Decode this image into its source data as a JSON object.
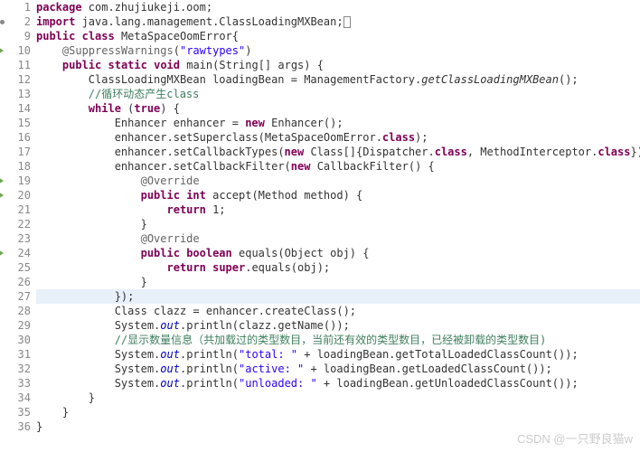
{
  "lines": [
    {
      "n": "1"
    },
    {
      "n": "2",
      "bullet": true
    },
    {
      "n": "9"
    },
    {
      "n": "10",
      "marker": true
    },
    {
      "n": "11"
    },
    {
      "n": "12"
    },
    {
      "n": "13"
    },
    {
      "n": "14"
    },
    {
      "n": "15"
    },
    {
      "n": "16"
    },
    {
      "n": "17"
    },
    {
      "n": "18"
    },
    {
      "n": "19",
      "marker": true
    },
    {
      "n": "20",
      "marker": true
    },
    {
      "n": "21"
    },
    {
      "n": "22"
    },
    {
      "n": "23"
    },
    {
      "n": "24",
      "marker": true
    },
    {
      "n": "25"
    },
    {
      "n": "26"
    },
    {
      "n": "27",
      "hl": true
    },
    {
      "n": "28"
    },
    {
      "n": "29"
    },
    {
      "n": "30"
    },
    {
      "n": "31"
    },
    {
      "n": "32"
    },
    {
      "n": "33"
    },
    {
      "n": "34"
    },
    {
      "n": "35"
    },
    {
      "n": "36"
    }
  ],
  "t": {
    "pkg": "package",
    "imp": "import",
    "pub": "public",
    "cls": "class",
    "stat": "static",
    "void": "void",
    "while": "while",
    "true": "true",
    "new": "new",
    "int": "int",
    "bool": "boolean",
    "ret": "return",
    "sup": "super",
    "pkgName": " com.zhujiukeji.oom;",
    "impName": " java.lang.management.ClassLoadingMXBean;",
    "className": " MetaSpaceOomError{",
    "annSup": "@SuppressWarnings",
    "annSupArg": "(",
    "rawtypes": "\"rawtypes\"",
    "annSupEnd": ")",
    "mainSig": " main(String[] args) {",
    "l12a": "ClassLoadingMXBean loadingBean = ManagementFactory.",
    "l12b": "getClassLoadingMXBean",
    "l12c": "();",
    "c13": "//循环动态产生class",
    "l14": " (",
    ") {": ") {",
    "l15a": "Enhancer enhancer = ",
    "l15b": " Enhancer();",
    "l16": "enhancer.setSuperclass(MetaSpaceOomError.",
    "l16b": "class",
    "l16c": ");",
    "l17a": "enhancer.setCallbackTypes(",
    "l17b": " Class[]{Dispatcher.",
    "l17c": ", MethodInterceptor.",
    "l17d": "});",
    "l18a": "enhancer.setCallbackFilter(",
    "l18b": " CallbackFilter() {",
    "ovr": "@Override",
    "l20": " accept(Method method) {",
    "l21": " 1;",
    "rb": "}",
    "l24": " equals(Object obj) {",
    "l25": ".equals(obj);",
    "l27": "});",
    "l28": "Class clazz = enhancer.createClass();",
    "l29a": "System.",
    "out": "out",
    "l29b": ".println(clazz.getName());",
    "c30": "//显示数量信息（共加载过的类型数目，当前还有效的类型数目，已经被卸载的类型数目)",
    "l31b": ".println(",
    "s31": "\"total: \"",
    "l31c": " + loadingBean.getTotalLoadedClassCount());",
    "s32": "\"active: \"",
    "l32c": " + loadingBean.getLoadedClassCount());",
    "s33": "\"unloaded: \"",
    "l33c": " + loadingBean.getUnloadedClassCount());",
    "ind1": "    ",
    "ind2": "        ",
    "ind3": "            ",
    "ind4": "                ",
    "ind5": "                    ",
    "wm": "CSDN @一只野良猫w"
  }
}
